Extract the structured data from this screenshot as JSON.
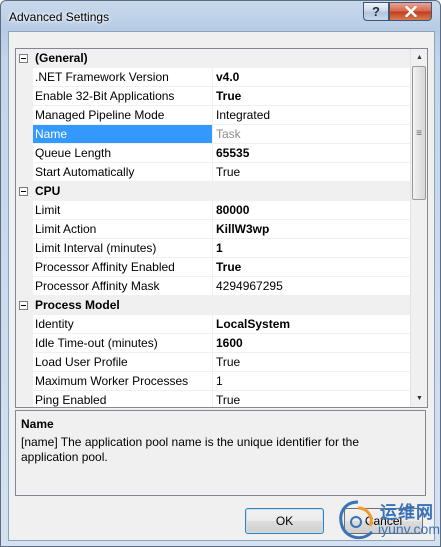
{
  "window": {
    "title": "Advanced Settings"
  },
  "caption": {
    "help_glyph": "?",
    "close_icon": "close-icon",
    "help_icon": "help-icon"
  },
  "grid": {
    "categories": [
      {
        "name": "(General)",
        "rows": [
          {
            "name": ".NET Framework Version",
            "value": "v4.0",
            "bold": true
          },
          {
            "name": "Enable 32-Bit Applications",
            "value": "True",
            "bold": true
          },
          {
            "name": "Managed Pipeline Mode",
            "value": "Integrated",
            "bold": false
          },
          {
            "name": "Name",
            "value": "Task",
            "bold": false,
            "selected": true,
            "readonly": true
          },
          {
            "name": "Queue Length",
            "value": "65535",
            "bold": true
          },
          {
            "name": "Start Automatically",
            "value": "True",
            "bold": false
          }
        ]
      },
      {
        "name": "CPU",
        "rows": [
          {
            "name": "Limit",
            "value": "80000",
            "bold": true
          },
          {
            "name": "Limit Action",
            "value": "KillW3wp",
            "bold": true
          },
          {
            "name": "Limit Interval (minutes)",
            "value": "1",
            "bold": true
          },
          {
            "name": "Processor Affinity Enabled",
            "value": "True",
            "bold": true
          },
          {
            "name": "Processor Affinity Mask",
            "value": "4294967295",
            "bold": false
          }
        ]
      },
      {
        "name": "Process Model",
        "rows": [
          {
            "name": "Identity",
            "value": "LocalSystem",
            "bold": true
          },
          {
            "name": "Idle Time-out (minutes)",
            "value": "1600",
            "bold": true
          },
          {
            "name": "Load User Profile",
            "value": "True",
            "bold": false
          },
          {
            "name": "Maximum Worker Processes",
            "value": "1",
            "bold": false
          },
          {
            "name": "Ping Enabled",
            "value": "True",
            "bold": false
          }
        ]
      }
    ]
  },
  "scrollbar": {
    "up_glyph": "▲",
    "down_glyph": "▼",
    "thumb_grip": "≡",
    "position": 0.0
  },
  "description": {
    "title": "Name",
    "text": "[name] The application pool name is the unique identifier for the application pool."
  },
  "buttons": {
    "ok": "OK",
    "cancel": "Cancel"
  },
  "watermark": {
    "text": "运维网",
    "url": "iyunv.com"
  }
}
